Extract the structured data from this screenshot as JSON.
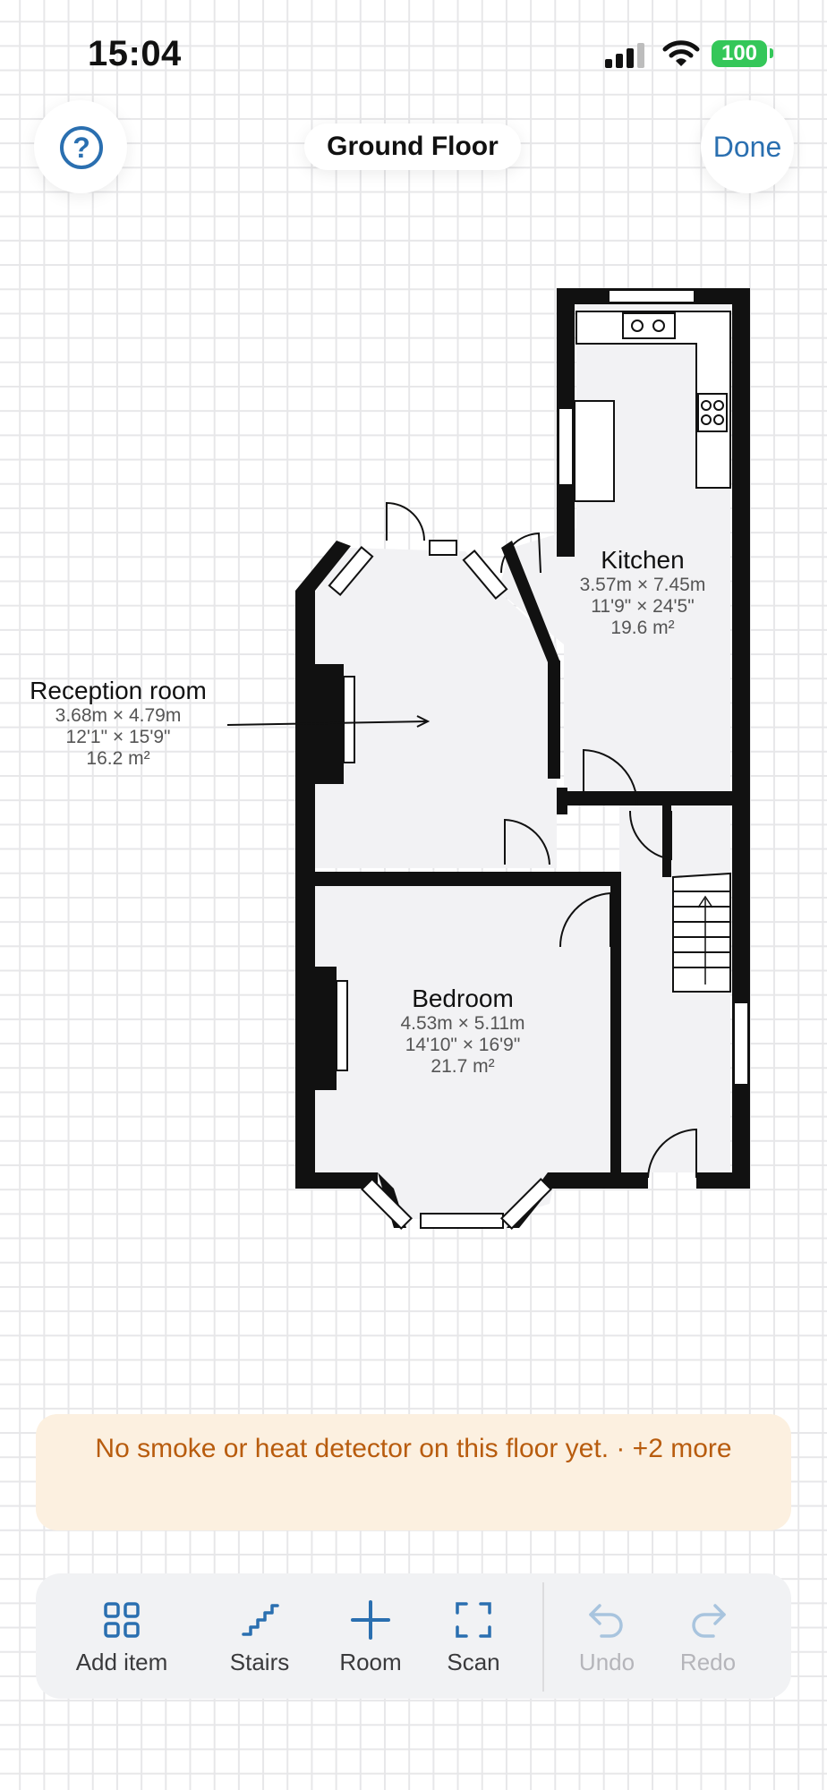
{
  "status": {
    "time": "15:04",
    "battery": "100"
  },
  "header": {
    "title": "Ground Floor",
    "done_label": "Done",
    "help_label": "?"
  },
  "rooms": [
    {
      "name": "Kitchen",
      "metric": "3.57m × 7.45m",
      "imperial": "11'9\" × 24'5\"",
      "area": "19.6 m²"
    },
    {
      "name": "Reception room",
      "metric": "3.68m × 4.79m",
      "imperial": "12'1\" × 15'9\"",
      "area": "16.2 m²"
    },
    {
      "name": "Bedroom",
      "metric": "4.53m × 5.11m",
      "imperial": "14'10\" × 16'9\"",
      "area": "21.7 m²"
    }
  ],
  "warning": {
    "text": "No smoke or heat detector on this floor yet.  ·  +2 more"
  },
  "toolbar": {
    "items": [
      {
        "label": "Add item",
        "icon": "grid-icon",
        "enabled": true
      },
      {
        "label": "Stairs",
        "icon": "stairs-icon",
        "enabled": true
      },
      {
        "label": "Room",
        "icon": "plus-icon",
        "enabled": true
      },
      {
        "label": "Scan",
        "icon": "scan-icon",
        "enabled": true
      },
      {
        "label": "Undo",
        "icon": "undo-icon",
        "enabled": false
      },
      {
        "label": "Redo",
        "icon": "redo-icon",
        "enabled": false
      }
    ]
  },
  "colors": {
    "accent": "#2a6fb0",
    "wall": "#111111",
    "room_fill": "#f2f2f4",
    "warning_bg": "#fcf0e0",
    "warning_text": "#b85c0e",
    "battery": "#34c759"
  }
}
